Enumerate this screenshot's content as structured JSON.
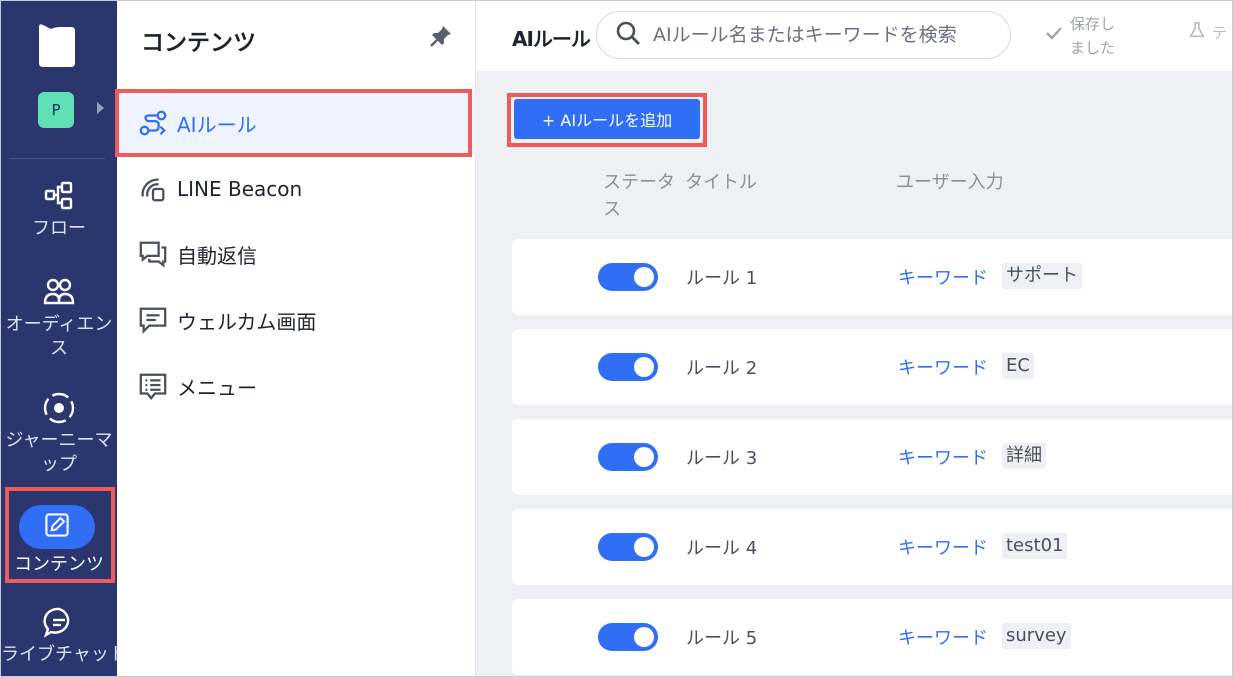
{
  "nav": {
    "project_initial": "P",
    "items": [
      {
        "label": "フロー",
        "icon": "flow-icon"
      },
      {
        "label": "オーディエンス",
        "icon": "audience-icon"
      },
      {
        "label": "ジャーニーマップ",
        "icon": "journey-map-icon"
      },
      {
        "label": "コンテンツ",
        "icon": "content-edit-icon"
      },
      {
        "label": "ライブチャット",
        "icon": "live-chat-icon"
      }
    ]
  },
  "sub": {
    "title": "コンテンツ",
    "items": [
      {
        "label": "AIルール",
        "icon": "ai-rule-icon"
      },
      {
        "label": "LINE Beacon",
        "icon": "beacon-icon"
      },
      {
        "label": "自動返信",
        "icon": "auto-reply-icon"
      },
      {
        "label": "ウェルカム画面",
        "icon": "welcome-icon"
      },
      {
        "label": "メニュー",
        "icon": "menu-icon"
      }
    ]
  },
  "main": {
    "title": "AIルール",
    "search_placeholder": "AIルール名またはキーワードを検索",
    "saved_line1": "保存し",
    "saved_line2": "ました",
    "extra_label": "テ",
    "add_button": "+ AIルールを追加",
    "columns": {
      "status_line1": "ステータ",
      "status_line2": "ス",
      "title": "タイトル",
      "user_input": "ユーザー入力"
    },
    "rows": [
      {
        "title": "ルール 1",
        "kind": "キーワード",
        "tag": "サポート",
        "enabled": true
      },
      {
        "title": "ルール 2",
        "kind": "キーワード",
        "tag": "EC",
        "enabled": true
      },
      {
        "title": "ルール 3",
        "kind": "キーワード",
        "tag": "詳細",
        "enabled": true
      },
      {
        "title": "ルール 4",
        "kind": "キーワード",
        "tag": "test01",
        "enabled": true
      },
      {
        "title": "ルール 5",
        "kind": "キーワード",
        "tag": "survey",
        "enabled": true
      }
    ]
  },
  "colors": {
    "nav_bg": "#2b356e",
    "accent": "#2f6ef5",
    "highlight": "#ef5a5a",
    "main_bg": "#eef0f4"
  }
}
